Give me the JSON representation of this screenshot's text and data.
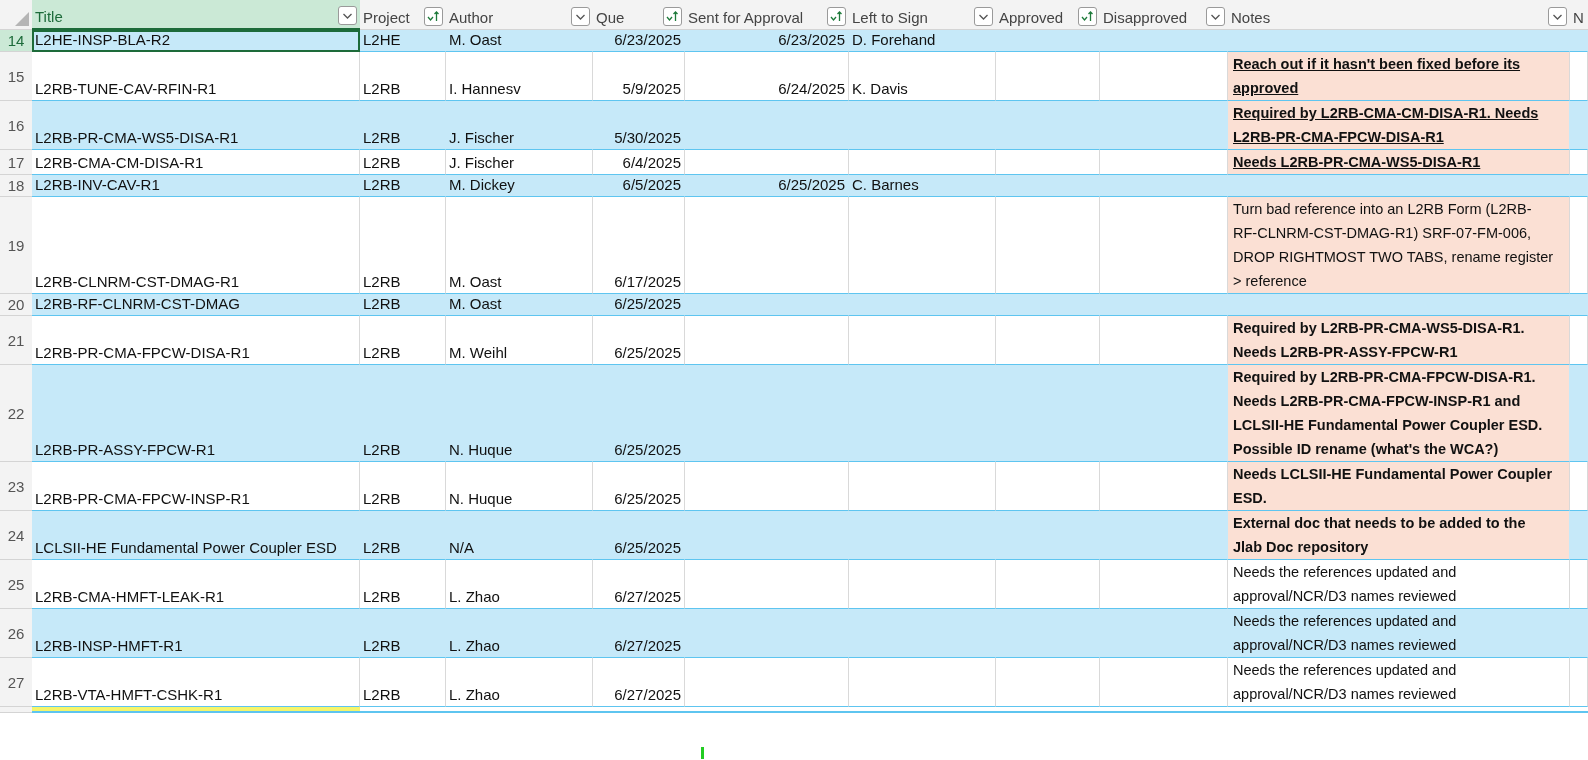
{
  "columns": [
    {
      "label": "Title",
      "kind": "dropdown",
      "selected": true
    },
    {
      "label": "Project",
      "kind": "sorted",
      "selected": false
    },
    {
      "label": "Author",
      "kind": "dropdown",
      "selected": false
    },
    {
      "label": "Que",
      "kind": "sorted",
      "selected": false
    },
    {
      "label": "Sent for Approval",
      "kind": "sorted",
      "selected": false
    },
    {
      "label": "Left to Sign",
      "kind": "dropdown",
      "selected": false
    },
    {
      "label": "Approved",
      "kind": "sorted",
      "selected": false
    },
    {
      "label": "Disapproved",
      "kind": "dropdown",
      "selected": false
    },
    {
      "label": "Notes",
      "kind": "dropdown",
      "selected": false
    },
    {
      "label": "N",
      "kind": "plain",
      "selected": false
    }
  ],
  "rows": [
    {
      "number": "14",
      "selected": true,
      "title": "L2HE-INSP-BLA-R2",
      "project": "L2HE",
      "author": "M. Oast",
      "que": "6/23/2025",
      "sent_for_approval": "6/23/2025",
      "left_to_sign": "D. Forehand",
      "notes": {
        "kind": "plain",
        "highlighted": false
      }
    },
    {
      "number": "15",
      "selected": false,
      "title": "L2RB-TUNE-CAV-RFIN-R1",
      "project": "L2RB",
      "author": "I. Hannesv",
      "que": "5/9/2025",
      "sent_for_approval": "6/24/2025",
      "left_to_sign": "K. Davis",
      "notes": {
        "text": "Reach out if it hasn't been fixed before its approved",
        "kind": "underlined",
        "highlighted": true
      }
    },
    {
      "number": "16",
      "selected": false,
      "title": "L2RB-PR-CMA-WS5-DISA-R1",
      "project": "L2RB",
      "author": "J. Fischer",
      "que": "5/30/2025",
      "sent_for_approval": "",
      "left_to_sign": "",
      "notes": {
        "text": "Required by L2RB-CMA-CM-DISA-R1. Needs L2RB-PR-CMA-FPCW-DISA-R1",
        "kind": "underlined",
        "highlighted": true
      }
    },
    {
      "number": "17",
      "selected": false,
      "title": "L2RB-CMA-CM-DISA-R1",
      "project": "L2RB",
      "author": "J. Fischer",
      "que": "6/4/2025",
      "sent_for_approval": "",
      "left_to_sign": "",
      "notes": {
        "text": "Needs L2RB-PR-CMA-WS5-DISA-R1",
        "kind": "underlined",
        "highlighted": true
      }
    },
    {
      "number": "18",
      "selected": false,
      "title": "L2RB-INV-CAV-R1",
      "project": "L2RB",
      "author": "M. Dickey",
      "que": "6/5/2025",
      "sent_for_approval": "6/25/2025",
      "left_to_sign": "C. Barnes",
      "notes": {
        "kind": "plain",
        "highlighted": false
      }
    },
    {
      "number": "19",
      "selected": false,
      "title": "L2RB-CLNRM-CST-DMAG-R1",
      "project": "L2RB",
      "author": "M. Oast",
      "que": "6/17/2025",
      "sent_for_approval": "",
      "left_to_sign": "",
      "notes": {
        "text": "Turn bad reference into an L2RB Form (L2RB-RF-CLNRM-CST-DMAG-R1) SRF-07-FM-006, DROP RIGHTMOST TWO TABS, rename register > reference",
        "kind": "plain",
        "highlighted": true
      }
    },
    {
      "number": "20",
      "selected": false,
      "title": "L2RB-RF-CLNRM-CST-DMAG",
      "project": "L2RB",
      "author": "M. Oast",
      "que": "6/25/2025",
      "sent_for_approval": "",
      "left_to_sign": "",
      "notes": {
        "kind": "plain",
        "highlighted": false
      }
    },
    {
      "number": "21",
      "selected": false,
      "title": "L2RB-PR-CMA-FPCW-DISA-R1",
      "project": "L2RB",
      "author": "M. Weihl",
      "que": "6/25/2025",
      "sent_for_approval": "",
      "left_to_sign": "",
      "notes": {
        "text": "Required by L2RB-PR-CMA-WS5-DISA-R1. Needs L2RB-PR-ASSY-FPCW-R1",
        "kind": "bold",
        "highlighted": true
      }
    },
    {
      "number": "22",
      "selected": false,
      "title": "L2RB-PR-ASSY-FPCW-R1",
      "project": "L2RB",
      "author": "N. Huque",
      "que": "6/25/2025",
      "sent_for_approval": "",
      "left_to_sign": "",
      "notes": {
        "text": "Required by L2RB-PR-CMA-FPCW-DISA-R1. Needs L2RB-PR-CMA-FPCW-INSP-R1 and LCLSII-HE Fundamental Power Coupler ESD. Possible ID rename (what's the WCA?)",
        "kind": "bold",
        "highlighted": true
      }
    },
    {
      "number": "23",
      "selected": false,
      "title": "L2RB-PR-CMA-FPCW-INSP-R1",
      "project": "L2RB",
      "author": "N. Huque",
      "que": "6/25/2025",
      "sent_for_approval": "",
      "left_to_sign": "",
      "notes": {
        "text": "Needs LCLSII-HE Fundamental Power Coupler ESD.",
        "kind": "bold",
        "highlighted": true
      }
    },
    {
      "number": "24",
      "selected": false,
      "title": "LCLSII-HE Fundamental Power Coupler ESD",
      "project": "L2RB",
      "author": "N/A",
      "que": "6/25/2025",
      "sent_for_approval": "",
      "left_to_sign": "",
      "notes": {
        "text": "External doc that needs to be added to the Jlab Doc repository",
        "kind": "bold",
        "highlighted": true
      }
    },
    {
      "number": "25",
      "selected": false,
      "title": "L2RB-CMA-HMFT-LEAK-R1",
      "project": "L2RB",
      "author": "L. Zhao",
      "que": "6/27/2025",
      "sent_for_approval": "",
      "left_to_sign": "",
      "notes": {
        "text": "Needs the references updated and approval/NCR/D3 names reviewed",
        "kind": "plain",
        "highlighted": false
      }
    },
    {
      "number": "26",
      "selected": false,
      "title": "L2RB-INSP-HMFT-R1",
      "project": "L2RB",
      "author": "L. Zhao",
      "que": "6/27/2025",
      "sent_for_approval": "",
      "left_to_sign": "",
      "notes": {
        "text": "Needs the references updated and approval/NCR/D3 names reviewed",
        "kind": "plain",
        "highlighted": false
      }
    },
    {
      "number": "27",
      "selected": false,
      "title": "L2RB-VTA-HMFT-CSHK-R1",
      "project": "L2RB",
      "author": "L. Zhao",
      "que": "6/27/2025",
      "sent_for_approval": "",
      "left_to_sign": "",
      "notes": {
        "text": "Needs the references updated and approval/NCR/D3 names reviewed",
        "kind": "plain",
        "highlighted": false
      }
    }
  ]
}
